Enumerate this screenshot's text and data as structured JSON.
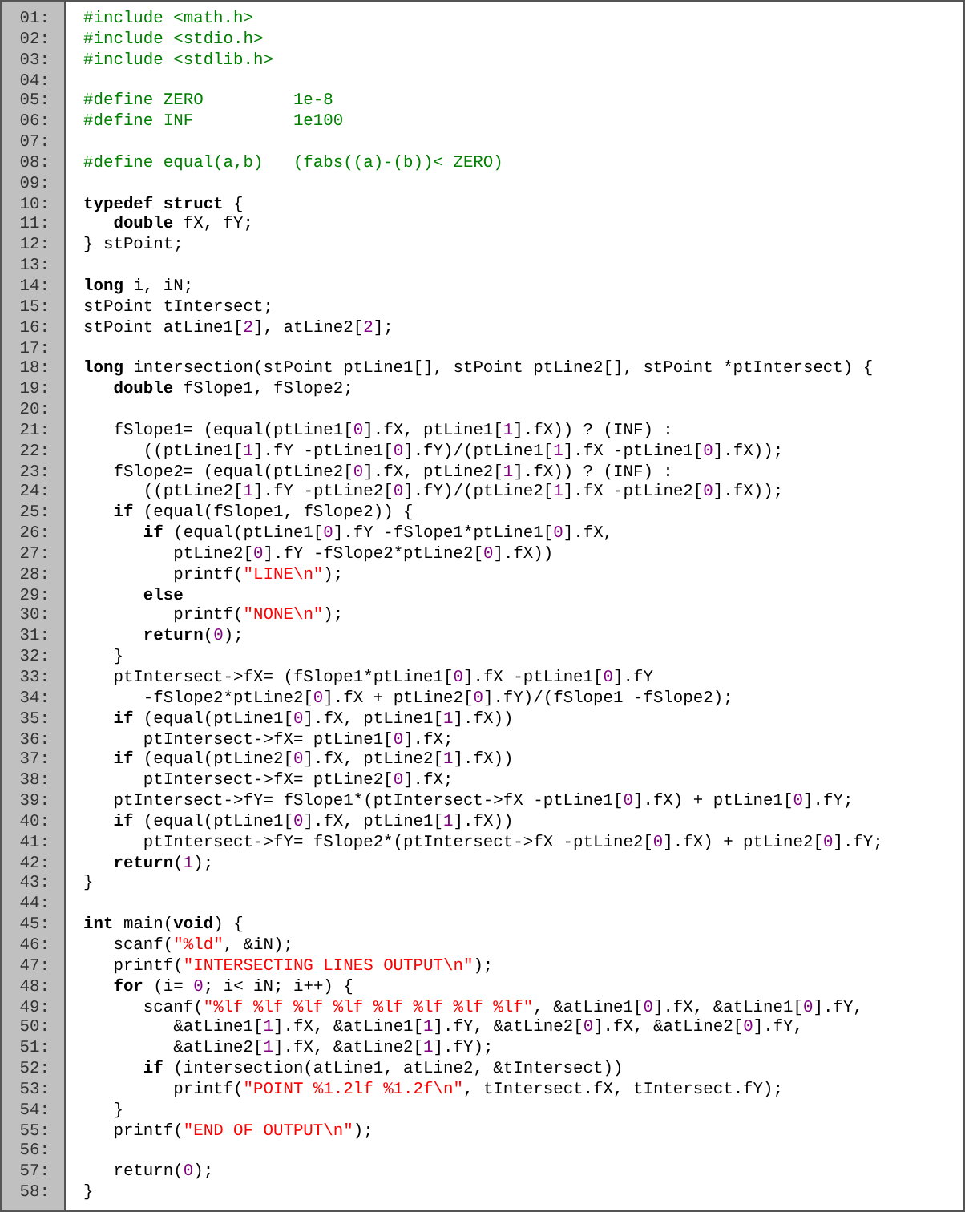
{
  "listing": {
    "lines": [
      {
        "number": "01:",
        "tokens": [
          {
            "kind": "directive",
            "text": "#include <math.h>"
          }
        ]
      },
      {
        "number": "02:",
        "tokens": [
          {
            "kind": "directive",
            "text": "#include <stdio.h>"
          }
        ]
      },
      {
        "number": "03:",
        "tokens": [
          {
            "kind": "directive",
            "text": "#include <stdlib.h>"
          }
        ]
      },
      {
        "number": "04:"
      },
      {
        "number": "05:",
        "tokens": [
          {
            "kind": "directive",
            "text": "#define ZERO         1e-8"
          }
        ]
      },
      {
        "number": "06:",
        "tokens": [
          {
            "kind": "directive",
            "text": "#define INF          1e100"
          }
        ]
      },
      {
        "number": "07:"
      },
      {
        "number": "08:",
        "tokens": [
          {
            "kind": "directive",
            "text": "#define equal(a,b)   (fabs((a)-(b))< ZERO)"
          }
        ]
      },
      {
        "number": "09:"
      },
      {
        "number": "10:",
        "tokens": [
          {
            "kind": "keyword",
            "text": "typedef struct"
          },
          {
            "kind": "plain",
            "text": " {"
          }
        ]
      },
      {
        "number": "11:",
        "tokens": [
          {
            "kind": "keyword",
            "text": "   double"
          },
          {
            "kind": "plain",
            "text": " fX, fY;"
          }
        ]
      },
      {
        "number": "12:",
        "tokens": [
          {
            "kind": "plain",
            "text": "} stPoint;"
          }
        ]
      },
      {
        "number": "13:"
      },
      {
        "number": "14:",
        "tokens": [
          {
            "kind": "keyword",
            "text": "long"
          },
          {
            "kind": "plain",
            "text": " i, iN;"
          }
        ]
      },
      {
        "number": "15:",
        "tokens": [
          {
            "kind": "plain",
            "text": "stPoint tIntersect;"
          }
        ]
      },
      {
        "number": "16:",
        "tokens": [
          {
            "kind": "plain",
            "text": "stPoint atLine1["
          },
          {
            "kind": "number",
            "text": "2"
          },
          {
            "kind": "plain",
            "text": "], atLine2["
          },
          {
            "kind": "number",
            "text": "2"
          },
          {
            "kind": "plain",
            "text": "];"
          }
        ]
      },
      {
        "number": "17:"
      },
      {
        "number": "18:",
        "tokens": [
          {
            "kind": "keyword",
            "text": "long"
          },
          {
            "kind": "plain",
            "text": " intersection(stPoint ptLine1[], stPoint ptLine2[], stPoint *ptIntersect) {"
          }
        ]
      },
      {
        "number": "19:",
        "tokens": [
          {
            "kind": "keyword",
            "text": "   double"
          },
          {
            "kind": "plain",
            "text": " fSlope1, fSlope2;"
          }
        ]
      },
      {
        "number": "20:"
      },
      {
        "number": "21:",
        "tokens": [
          {
            "kind": "plain",
            "text": "   fSlope1= (equal(ptLine1["
          },
          {
            "kind": "number",
            "text": "0"
          },
          {
            "kind": "plain",
            "text": "].fX, ptLine1["
          },
          {
            "kind": "number",
            "text": "1"
          },
          {
            "kind": "plain",
            "text": "].fX)) ? (INF) :"
          }
        ]
      },
      {
        "number": "22:",
        "tokens": [
          {
            "kind": "plain",
            "text": "      ((ptLine1["
          },
          {
            "kind": "number",
            "text": "1"
          },
          {
            "kind": "plain",
            "text": "].fY -ptLine1["
          },
          {
            "kind": "number",
            "text": "0"
          },
          {
            "kind": "plain",
            "text": "].fY)/(ptLine1["
          },
          {
            "kind": "number",
            "text": "1"
          },
          {
            "kind": "plain",
            "text": "].fX -ptLine1["
          },
          {
            "kind": "number",
            "text": "0"
          },
          {
            "kind": "plain",
            "text": "].fX));"
          }
        ]
      },
      {
        "number": "23:",
        "tokens": [
          {
            "kind": "plain",
            "text": "   fSlope2= (equal(ptLine2["
          },
          {
            "kind": "number",
            "text": "0"
          },
          {
            "kind": "plain",
            "text": "].fX, ptLine2["
          },
          {
            "kind": "number",
            "text": "1"
          },
          {
            "kind": "plain",
            "text": "].fX)) ? (INF) :"
          }
        ]
      },
      {
        "number": "24:",
        "tokens": [
          {
            "kind": "plain",
            "text": "      ((ptLine2["
          },
          {
            "kind": "number",
            "text": "1"
          },
          {
            "kind": "plain",
            "text": "].fY -ptLine2["
          },
          {
            "kind": "number",
            "text": "0"
          },
          {
            "kind": "plain",
            "text": "].fY)/(ptLine2["
          },
          {
            "kind": "number",
            "text": "1"
          },
          {
            "kind": "plain",
            "text": "].fX -ptLine2["
          },
          {
            "kind": "number",
            "text": "0"
          },
          {
            "kind": "plain",
            "text": "].fX));"
          }
        ]
      },
      {
        "number": "25:",
        "tokens": [
          {
            "kind": "keyword",
            "text": "   if"
          },
          {
            "kind": "plain",
            "text": " (equal(fSlope1, fSlope2)) {"
          }
        ]
      },
      {
        "number": "26:",
        "tokens": [
          {
            "kind": "keyword",
            "text": "      if"
          },
          {
            "kind": "plain",
            "text": " (equal(ptLine1["
          },
          {
            "kind": "number",
            "text": "0"
          },
          {
            "kind": "plain",
            "text": "].fY -fSlope1*ptLine1["
          },
          {
            "kind": "number",
            "text": "0"
          },
          {
            "kind": "plain",
            "text": "].fX,"
          }
        ]
      },
      {
        "number": "27:",
        "tokens": [
          {
            "kind": "plain",
            "text": "         ptLine2["
          },
          {
            "kind": "number",
            "text": "0"
          },
          {
            "kind": "plain",
            "text": "].fY -fSlope2*ptLine2["
          },
          {
            "kind": "number",
            "text": "0"
          },
          {
            "kind": "plain",
            "text": "].fX))"
          }
        ]
      },
      {
        "number": "28:",
        "tokens": [
          {
            "kind": "plain",
            "text": "         printf("
          },
          {
            "kind": "string",
            "text": "\"LINE\\n\""
          },
          {
            "kind": "plain",
            "text": ");"
          }
        ]
      },
      {
        "number": "29:",
        "tokens": [
          {
            "kind": "keyword",
            "text": "      else"
          }
        ]
      },
      {
        "number": "30:",
        "tokens": [
          {
            "kind": "plain",
            "text": "         printf("
          },
          {
            "kind": "string",
            "text": "\"NONE\\n\""
          },
          {
            "kind": "plain",
            "text": ");"
          }
        ]
      },
      {
        "number": "31:",
        "tokens": [
          {
            "kind": "keyword",
            "text": "      return"
          },
          {
            "kind": "plain",
            "text": "("
          },
          {
            "kind": "number",
            "text": "0"
          },
          {
            "kind": "plain",
            "text": ");"
          }
        ]
      },
      {
        "number": "32:",
        "tokens": [
          {
            "kind": "plain",
            "text": "   }"
          }
        ]
      },
      {
        "number": "33:",
        "tokens": [
          {
            "kind": "plain",
            "text": "   ptIntersect->fX= (fSlope1*ptLine1["
          },
          {
            "kind": "number",
            "text": "0"
          },
          {
            "kind": "plain",
            "text": "].fX -ptLine1["
          },
          {
            "kind": "number",
            "text": "0"
          },
          {
            "kind": "plain",
            "text": "].fY"
          }
        ]
      },
      {
        "number": "34:",
        "tokens": [
          {
            "kind": "plain",
            "text": "      -fSlope2*ptLine2["
          },
          {
            "kind": "number",
            "text": "0"
          },
          {
            "kind": "plain",
            "text": "].fX + ptLine2["
          },
          {
            "kind": "number",
            "text": "0"
          },
          {
            "kind": "plain",
            "text": "].fY)/(fSlope1 -fSlope2);"
          }
        ]
      },
      {
        "number": "35:",
        "tokens": [
          {
            "kind": "keyword",
            "text": "   if"
          },
          {
            "kind": "plain",
            "text": " (equal(ptLine1["
          },
          {
            "kind": "number",
            "text": "0"
          },
          {
            "kind": "plain",
            "text": "].fX, ptLine1["
          },
          {
            "kind": "number",
            "text": "1"
          },
          {
            "kind": "plain",
            "text": "].fX))"
          }
        ]
      },
      {
        "number": "36:",
        "tokens": [
          {
            "kind": "plain",
            "text": "      ptIntersect->fX= ptLine1["
          },
          {
            "kind": "number",
            "text": "0"
          },
          {
            "kind": "plain",
            "text": "].fX;"
          }
        ]
      },
      {
        "number": "37:",
        "tokens": [
          {
            "kind": "keyword",
            "text": "   if"
          },
          {
            "kind": "plain",
            "text": " (equal(ptLine2["
          },
          {
            "kind": "number",
            "text": "0"
          },
          {
            "kind": "plain",
            "text": "].fX, ptLine2["
          },
          {
            "kind": "number",
            "text": "1"
          },
          {
            "kind": "plain",
            "text": "].fX))"
          }
        ]
      },
      {
        "number": "38:",
        "tokens": [
          {
            "kind": "plain",
            "text": "      ptIntersect->fX= ptLine2["
          },
          {
            "kind": "number",
            "text": "0"
          },
          {
            "kind": "plain",
            "text": "].fX;"
          }
        ]
      },
      {
        "number": "39:",
        "tokens": [
          {
            "kind": "plain",
            "text": "   ptIntersect->fY= fSlope1*(ptIntersect->fX -ptLine1["
          },
          {
            "kind": "number",
            "text": "0"
          },
          {
            "kind": "plain",
            "text": "].fX) + ptLine1["
          },
          {
            "kind": "number",
            "text": "0"
          },
          {
            "kind": "plain",
            "text": "].fY;"
          }
        ]
      },
      {
        "number": "40:",
        "tokens": [
          {
            "kind": "keyword",
            "text": "   if"
          },
          {
            "kind": "plain",
            "text": " (equal(ptLine1["
          },
          {
            "kind": "number",
            "text": "0"
          },
          {
            "kind": "plain",
            "text": "].fX, ptLine1["
          },
          {
            "kind": "number",
            "text": "1"
          },
          {
            "kind": "plain",
            "text": "].fX))"
          }
        ]
      },
      {
        "number": "41:",
        "tokens": [
          {
            "kind": "plain",
            "text": "      ptIntersect->fY= fSlope2*(ptIntersect->fX -ptLine2["
          },
          {
            "kind": "number",
            "text": "0"
          },
          {
            "kind": "plain",
            "text": "].fX) + ptLine2["
          },
          {
            "kind": "number",
            "text": "0"
          },
          {
            "kind": "plain",
            "text": "].fY;"
          }
        ]
      },
      {
        "number": "42:",
        "tokens": [
          {
            "kind": "keyword",
            "text": "   return"
          },
          {
            "kind": "plain",
            "text": "("
          },
          {
            "kind": "number",
            "text": "1"
          },
          {
            "kind": "plain",
            "text": ");"
          }
        ]
      },
      {
        "number": "43:",
        "tokens": [
          {
            "kind": "plain",
            "text": "}"
          }
        ]
      },
      {
        "number": "44:"
      },
      {
        "number": "45:",
        "tokens": [
          {
            "kind": "keyword",
            "text": "int"
          },
          {
            "kind": "plain",
            "text": " main("
          },
          {
            "kind": "keyword",
            "text": "void"
          },
          {
            "kind": "plain",
            "text": ") {"
          }
        ]
      },
      {
        "number": "46:",
        "tokens": [
          {
            "kind": "plain",
            "text": "   scanf("
          },
          {
            "kind": "string",
            "text": "\"%ld\""
          },
          {
            "kind": "plain",
            "text": ", &iN);"
          }
        ]
      },
      {
        "number": "47:",
        "tokens": [
          {
            "kind": "plain",
            "text": "   printf("
          },
          {
            "kind": "string",
            "text": "\"INTERSECTING LINES OUTPUT\\n\""
          },
          {
            "kind": "plain",
            "text": ");"
          }
        ]
      },
      {
        "number": "48:",
        "tokens": [
          {
            "kind": "keyword",
            "text": "   for"
          },
          {
            "kind": "plain",
            "text": " (i= "
          },
          {
            "kind": "number",
            "text": "0"
          },
          {
            "kind": "plain",
            "text": "; i< iN; i++) {"
          }
        ]
      },
      {
        "number": "49:",
        "tokens": [
          {
            "kind": "plain",
            "text": "      scanf("
          },
          {
            "kind": "string",
            "text": "\"%lf %lf %lf %lf %lf %lf %lf %lf\""
          },
          {
            "kind": "plain",
            "text": ", &atLine1["
          },
          {
            "kind": "number",
            "text": "0"
          },
          {
            "kind": "plain",
            "text": "].fX, &atLine1["
          },
          {
            "kind": "number",
            "text": "0"
          },
          {
            "kind": "plain",
            "text": "].fY,"
          }
        ]
      },
      {
        "number": "50:",
        "tokens": [
          {
            "kind": "plain",
            "text": "         &atLine1["
          },
          {
            "kind": "number",
            "text": "1"
          },
          {
            "kind": "plain",
            "text": "].fX, &atLine1["
          },
          {
            "kind": "number",
            "text": "1"
          },
          {
            "kind": "plain",
            "text": "].fY, &atLine2["
          },
          {
            "kind": "number",
            "text": "0"
          },
          {
            "kind": "plain",
            "text": "].fX, &atLine2["
          },
          {
            "kind": "number",
            "text": "0"
          },
          {
            "kind": "plain",
            "text": "].fY,"
          }
        ]
      },
      {
        "number": "51:",
        "tokens": [
          {
            "kind": "plain",
            "text": "         &atLine2["
          },
          {
            "kind": "number",
            "text": "1"
          },
          {
            "kind": "plain",
            "text": "].fX, &atLine2["
          },
          {
            "kind": "number",
            "text": "1"
          },
          {
            "kind": "plain",
            "text": "].fY);"
          }
        ]
      },
      {
        "number": "52:",
        "tokens": [
          {
            "kind": "keyword",
            "text": "      if"
          },
          {
            "kind": "plain",
            "text": " (intersection(atLine1, atLine2, &tIntersect))"
          }
        ]
      },
      {
        "number": "53:",
        "tokens": [
          {
            "kind": "plain",
            "text": "         printf("
          },
          {
            "kind": "string",
            "text": "\"POINT %1.2lf %1.2f\\n\""
          },
          {
            "kind": "plain",
            "text": ", tIntersect.fX, tIntersect.fY);"
          }
        ]
      },
      {
        "number": "54:",
        "tokens": [
          {
            "kind": "plain",
            "text": "   }"
          }
        ]
      },
      {
        "number": "55:",
        "tokens": [
          {
            "kind": "plain",
            "text": "   printf("
          },
          {
            "kind": "string",
            "text": "\"END OF OUTPUT\\n\""
          },
          {
            "kind": "plain",
            "text": ");"
          }
        ]
      },
      {
        "number": "56:"
      },
      {
        "number": "57:",
        "tokens": [
          {
            "kind": "plain",
            "text": "   return("
          },
          {
            "kind": "number",
            "text": "0"
          },
          {
            "kind": "plain",
            "text": ");"
          }
        ]
      },
      {
        "number": "58:",
        "tokens": [
          {
            "kind": "plain",
            "text": "}"
          }
        ]
      }
    ]
  }
}
